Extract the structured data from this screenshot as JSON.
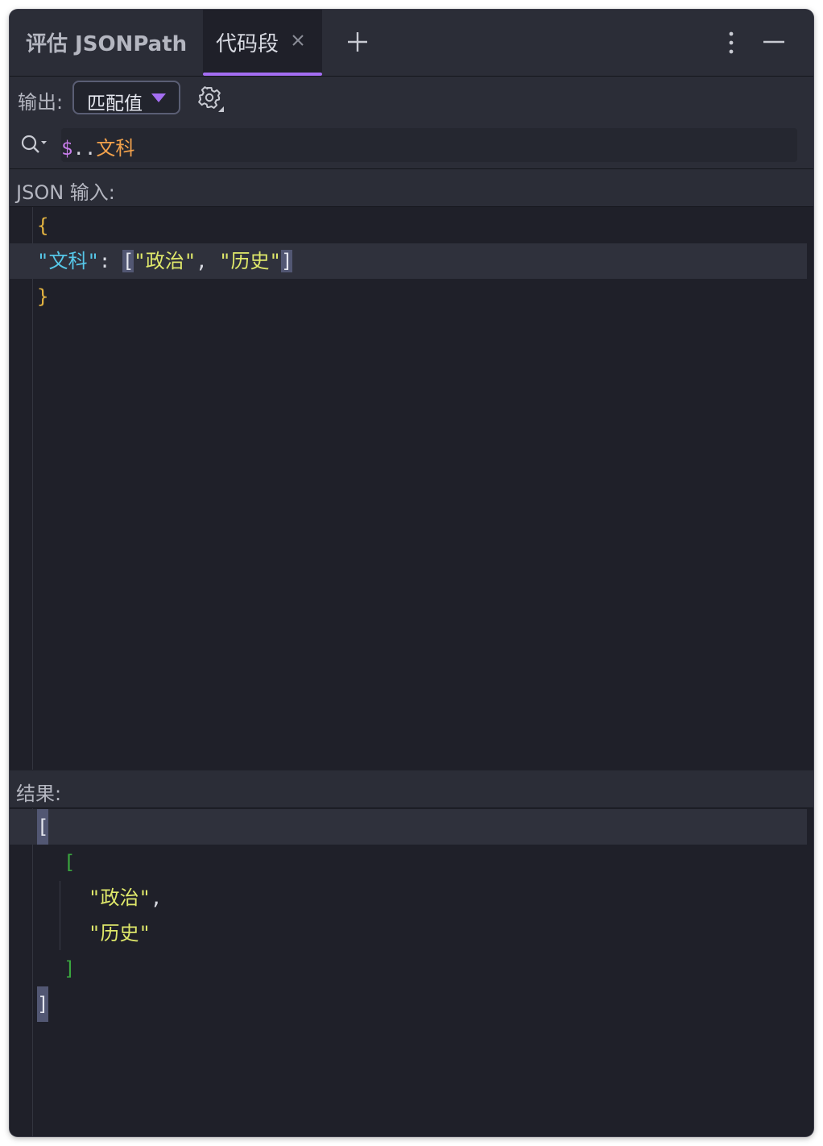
{
  "header": {
    "tool_title": "评估 JSONPath",
    "tab_label": "代码段"
  },
  "output": {
    "label": "输出:",
    "selected": "匹配值"
  },
  "search": {
    "dollar": "$",
    "dots": "..",
    "key": "文科"
  },
  "json_input": {
    "header": "JSON 输入:",
    "open_brace": "{",
    "key": "\"文科\"",
    "colon": ": ",
    "open_bracket": "[",
    "value_1": "\"政治\"",
    "comma": ", ",
    "value_2": "\"历史\"",
    "close_bracket": "]",
    "close_brace": "}"
  },
  "result": {
    "header": "结果:",
    "outer_open": "[",
    "inner_open": "[",
    "value_1": "\"政治\"",
    "comma": ",",
    "value_2": "\"历史\"",
    "inner_close": "]",
    "outer_close": "]"
  },
  "colors": {
    "accent": "#a46ef2",
    "key": "#56c7e8",
    "string": "#dfe86a",
    "brace": "#e3b341",
    "query_key": "#f0a04b"
  }
}
